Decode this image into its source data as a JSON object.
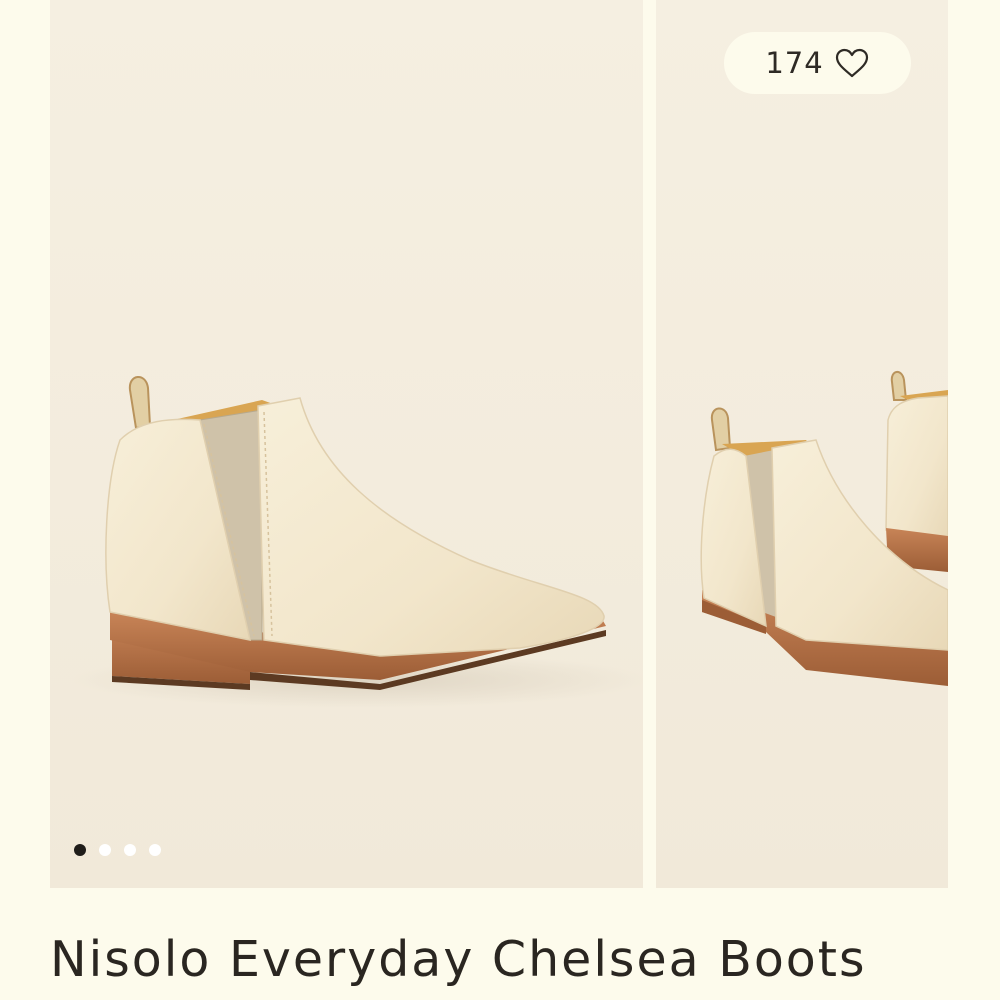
{
  "likes": {
    "count": "174"
  },
  "gallery": {
    "slide_count": 4,
    "active_index": 0
  },
  "product": {
    "title": "Nisolo Everyday Chelsea Boots"
  },
  "colors": {
    "background": "#fdfbec",
    "photo_bg": "#f3ecdd",
    "boot_leather": "#f4e9cf",
    "boot_sole": "#b9764a",
    "elastic_panel": "#cfc2a9",
    "dot_active": "#1f1d1a",
    "dot_inactive": "#ffffff"
  }
}
